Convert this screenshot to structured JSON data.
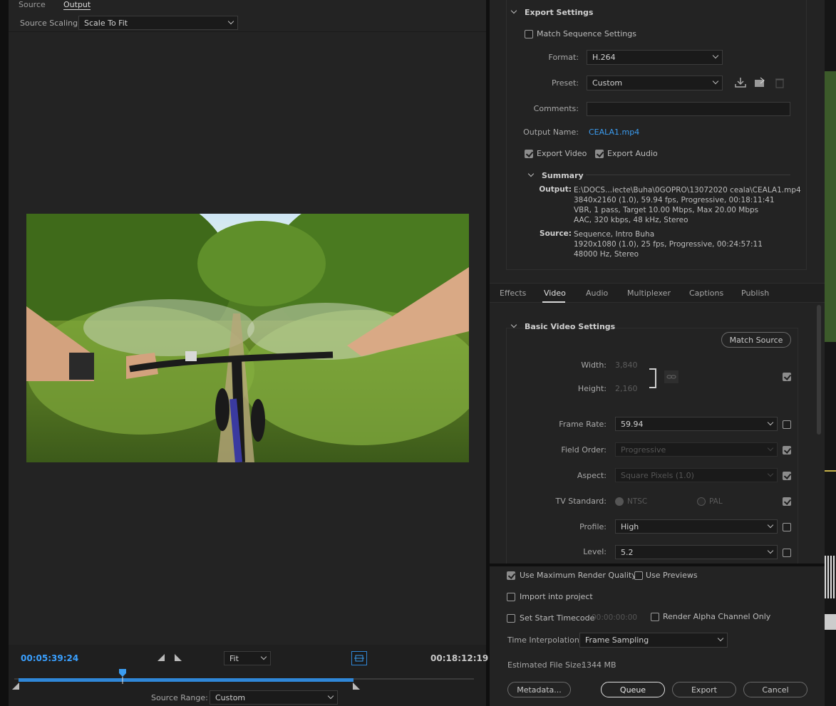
{
  "left_panel": {
    "tabs": [
      {
        "label": "Source"
      },
      {
        "label": "Output"
      }
    ],
    "source_scaling_label": "Source Scaling:",
    "source_scaling_value": "Scale To Fit"
  },
  "timeline": {
    "current_time": "00:05:39:24",
    "zoom_value": "Fit",
    "end_time": "00:18:12:19",
    "source_range_label": "Source Range:",
    "source_range_value": "Custom",
    "playhead_fraction": 0.31
  },
  "export_settings": {
    "title": "Export Settings",
    "match_sequence_label": "Match Sequence Settings",
    "format_label": "Format:",
    "format_value": "H.264",
    "preset_label": "Preset:",
    "preset_value": "Custom",
    "comments_label": "Comments:",
    "comments_value": "",
    "output_name_label": "Output Name:",
    "output_name_value": "CEALA1.mp4",
    "export_video_label": "Export Video",
    "export_audio_label": "Export Audio"
  },
  "summary": {
    "title": "Summary",
    "output_label": "Output:",
    "output_lines": [
      "E:\\DOCS...iecte\\Buha\\0GOPRO\\13072020 ceala\\CEALA1.mp4",
      "3840x2160 (1.0), 59.94 fps, Progressive, 00:18:11:41",
      "VBR, 1 pass, Target 10.00 Mbps, Max 20.00 Mbps",
      "AAC, 320 kbps, 48 kHz, Stereo"
    ],
    "source_label": "Source:",
    "source_lines": [
      "Sequence, Intro Buha",
      "1920x1080 (1.0), 25 fps, Progressive, 00:24:57:11",
      "48000 Hz, Stereo"
    ]
  },
  "panel_tabs": [
    {
      "label": "Effects"
    },
    {
      "label": "Video"
    },
    {
      "label": "Audio"
    },
    {
      "label": "Multiplexer"
    },
    {
      "label": "Captions"
    },
    {
      "label": "Publish"
    }
  ],
  "basic_video": {
    "title": "Basic Video Settings",
    "match_source_label": "Match Source",
    "width_label": "Width:",
    "width_value": "3,840",
    "height_label": "Height:",
    "height_value": "2,160",
    "frame_rate_label": "Frame Rate:",
    "frame_rate_value": "59.94",
    "field_order_label": "Field Order:",
    "field_order_value": "Progressive",
    "aspect_label": "Aspect:",
    "aspect_value": "Square Pixels (1.0)",
    "tv_standard_label": "TV Standard:",
    "ntsc_label": "NTSC",
    "pal_label": "PAL",
    "profile_label": "Profile:",
    "profile_value": "High",
    "level_label": "Level:",
    "level_value": "5.2"
  },
  "bottom": {
    "max_render_label": "Use Maximum Render Quality",
    "use_previews_label": "Use Previews",
    "import_label": "Import into project",
    "start_timecode_label": "Set Start Timecode",
    "start_timecode_value": "00:00:00:00",
    "alpha_label": "Render Alpha Channel Only",
    "time_interp_label": "Time Interpolation:",
    "time_interp_value": "Frame Sampling",
    "file_size_label": "Estimated File Size:",
    "file_size_value": "1344 MB",
    "metadata_button": "Metadata...",
    "queue_button": "Queue",
    "export_button": "Export",
    "cancel_button": "Cancel"
  },
  "colors": {
    "accent": "#3b9cf0",
    "panel": "#232323",
    "timeline_bar": "#2f87d8"
  }
}
